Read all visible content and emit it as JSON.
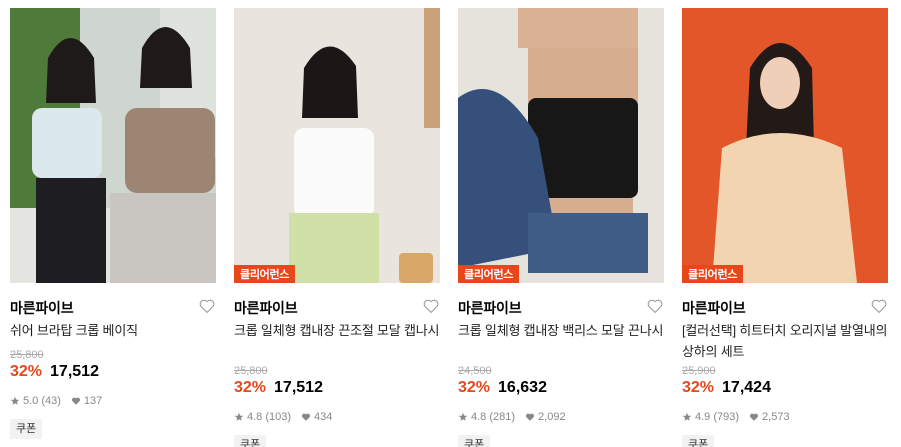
{
  "products": [
    {
      "brand": "마른파이브",
      "title": "쉬어 브라탑 크롭 베이직",
      "badge": "",
      "original_price": "25,800",
      "discount": "32%",
      "price": "17,512",
      "rating": "5.0 (43)",
      "likes": "137",
      "coupon": "쿠폰"
    },
    {
      "brand": "마른파이브",
      "title": "크롭 일체형 캡내장 끈조절 모달 캡나시",
      "badge": "클리어런스",
      "original_price": "25,800",
      "discount": "32%",
      "price": "17,512",
      "rating": "4.8 (103)",
      "likes": "434",
      "coupon": "쿠폰"
    },
    {
      "brand": "마른파이브",
      "title": "크롭 일체형 캡내장 백리스 모달 끈나시",
      "badge": "클리어런스",
      "original_price": "24,500",
      "discount": "32%",
      "price": "16,632",
      "rating": "4.8 (281)",
      "likes": "2,092",
      "coupon": "쿠폰"
    },
    {
      "brand": "마른파이브",
      "title": "[컬러선택] 히트터치 오리지널 발열내의 상하의 세트",
      "badge": "클리어런스",
      "original_price": "25,900",
      "discount": "32%",
      "price": "17,424",
      "rating": "4.9 (793)",
      "likes": "2,573",
      "coupon": "쿠폰"
    }
  ],
  "colors": {
    "accent": "#e8471c",
    "text": "#000000",
    "muted": "#888888",
    "strike": "#aaaaaa"
  },
  "icons": [
    "heart-outline-icon",
    "star-icon",
    "heart-filled-icon"
  ]
}
